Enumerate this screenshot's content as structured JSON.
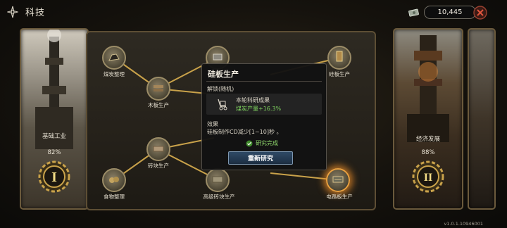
{
  "header": {
    "title": "科技",
    "back_icon": "compass-back-icon",
    "currency_amount": "10,445",
    "currency_icon": "cash-bundle-icon",
    "close_icon": "close-icon"
  },
  "left_panel": {
    "label": "基础工业",
    "percent": "82%",
    "badge": "I"
  },
  "right_panel": {
    "label": "经济发展",
    "percent": "88%",
    "badge": "II"
  },
  "nodes": [
    {
      "label": "煤炭整理",
      "icon": "coal-icon"
    },
    {
      "label": "木板生产",
      "icon": "wood-plank-icon"
    },
    {
      "label": "砖块生产",
      "icon": "brick-icon"
    },
    {
      "label": "食物整理",
      "icon": "food-icon"
    },
    {
      "label": "高级砖块生产",
      "icon": "advanced-brick-icon"
    },
    {
      "label": "硅板生产",
      "icon": "silicon-plate-icon"
    },
    {
      "label": "电路板生产",
      "icon": "circuit-board-icon"
    }
  ],
  "popup": {
    "title": "硅板生产",
    "unlock_label": "解锁(随机)",
    "reward_heading": "本轮科研成果",
    "reward_text": "煤炭产量+16.3%",
    "effect_label": "效果",
    "effect_text": "硅板制作CD减少[1~10]秒 。",
    "status": "研究完成",
    "button_label": "重新研究"
  },
  "version": "v1.0.1.10946001",
  "colors": {
    "accent_gold": "#c9a24a",
    "success_green": "#7fd35f",
    "button_blue": "#2f4a66"
  }
}
